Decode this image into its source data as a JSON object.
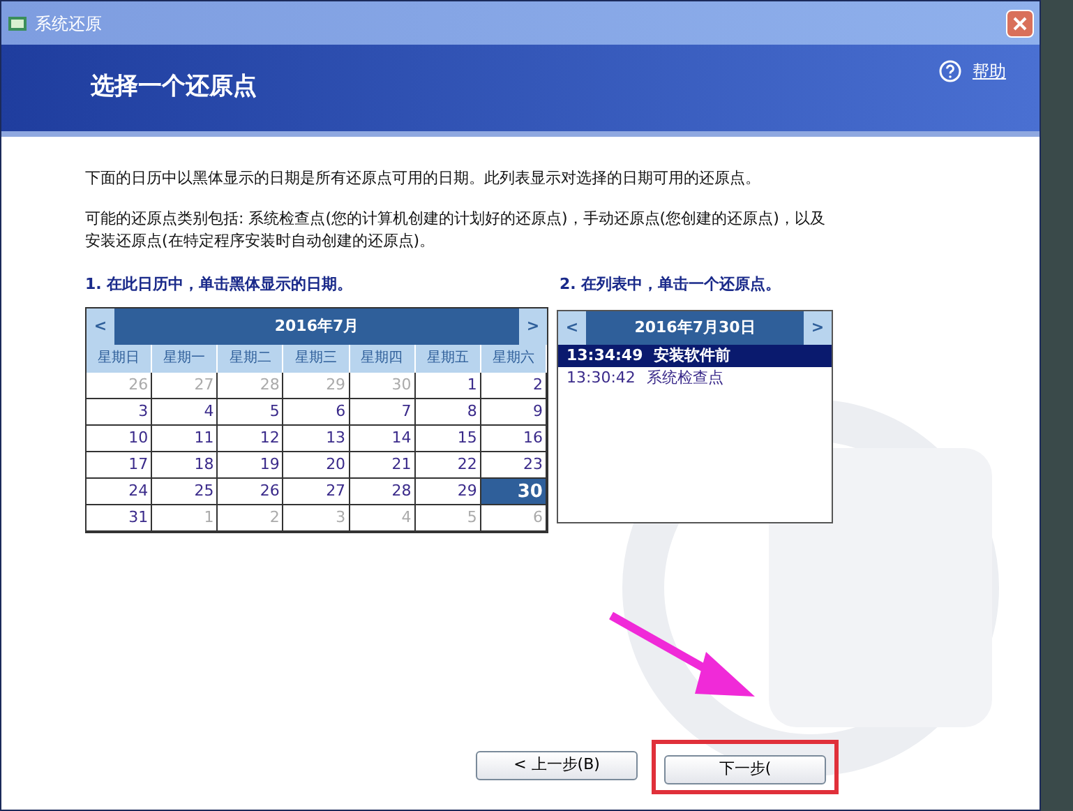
{
  "window": {
    "title": "系统还原"
  },
  "header": {
    "title": "选择一个还原点",
    "help": "帮助"
  },
  "description": "下面的日历中以黑体显示的日期是所有还原点可用的日期。此列表显示对选择的日期可用的还原点。",
  "types_note": "可能的还原点类别包括: 系统检查点(您的计算机创建的计划好的还原点)，手动还原点(您创建的还原点)，以及安装还原点(在特定程序安装时自动创建的还原点)。",
  "step1": "1. 在此日历中，单击黑体显示的日期。",
  "step2": "2. 在列表中，单击一个还原点。",
  "calendar": {
    "prev": "<",
    "next": ">",
    "month": "2016年7月",
    "weekdays": [
      "星期日",
      "星期一",
      "星期二",
      "星期三",
      "星期四",
      "星期五",
      "星期六"
    ],
    "weeks": [
      [
        {
          "day": "26",
          "in_month": false,
          "selected": false
        },
        {
          "day": "27",
          "in_month": false,
          "selected": false
        },
        {
          "day": "28",
          "in_month": false,
          "selected": false
        },
        {
          "day": "29",
          "in_month": false,
          "selected": false
        },
        {
          "day": "30",
          "in_month": false,
          "selected": false
        },
        {
          "day": "1",
          "in_month": true,
          "selected": false
        },
        {
          "day": "2",
          "in_month": true,
          "selected": false
        }
      ],
      [
        {
          "day": "3",
          "in_month": true,
          "selected": false
        },
        {
          "day": "4",
          "in_month": true,
          "selected": false
        },
        {
          "day": "5",
          "in_month": true,
          "selected": false
        },
        {
          "day": "6",
          "in_month": true,
          "selected": false
        },
        {
          "day": "7",
          "in_month": true,
          "selected": false
        },
        {
          "day": "8",
          "in_month": true,
          "selected": false
        },
        {
          "day": "9",
          "in_month": true,
          "selected": false
        }
      ],
      [
        {
          "day": "10",
          "in_month": true,
          "selected": false
        },
        {
          "day": "11",
          "in_month": true,
          "selected": false
        },
        {
          "day": "12",
          "in_month": true,
          "selected": false
        },
        {
          "day": "13",
          "in_month": true,
          "selected": false
        },
        {
          "day": "14",
          "in_month": true,
          "selected": false
        },
        {
          "day": "15",
          "in_month": true,
          "selected": false
        },
        {
          "day": "16",
          "in_month": true,
          "selected": false
        }
      ],
      [
        {
          "day": "17",
          "in_month": true,
          "selected": false
        },
        {
          "day": "18",
          "in_month": true,
          "selected": false
        },
        {
          "day": "19",
          "in_month": true,
          "selected": false
        },
        {
          "day": "20",
          "in_month": true,
          "selected": false
        },
        {
          "day": "21",
          "in_month": true,
          "selected": false
        },
        {
          "day": "22",
          "in_month": true,
          "selected": false
        },
        {
          "day": "23",
          "in_month": true,
          "selected": false
        }
      ],
      [
        {
          "day": "24",
          "in_month": true,
          "selected": false
        },
        {
          "day": "25",
          "in_month": true,
          "selected": false
        },
        {
          "day": "26",
          "in_month": true,
          "selected": false
        },
        {
          "day": "27",
          "in_month": true,
          "selected": false
        },
        {
          "day": "28",
          "in_month": true,
          "selected": false
        },
        {
          "day": "29",
          "in_month": true,
          "selected": false
        },
        {
          "day": "30",
          "in_month": true,
          "selected": true
        }
      ],
      [
        {
          "day": "31",
          "in_month": true,
          "selected": false
        },
        {
          "day": "1",
          "in_month": false,
          "selected": false
        },
        {
          "day": "2",
          "in_month": false,
          "selected": false
        },
        {
          "day": "3",
          "in_month": false,
          "selected": false
        },
        {
          "day": "4",
          "in_month": false,
          "selected": false
        },
        {
          "day": "5",
          "in_month": false,
          "selected": false
        },
        {
          "day": "6",
          "in_month": false,
          "selected": false
        }
      ]
    ]
  },
  "restore_points": {
    "prev": "<",
    "next": ">",
    "date": "2016年7月30日",
    "items": [
      {
        "time": "13:34:49",
        "name": "安装软件前",
        "selected": true
      },
      {
        "time": "13:30:42",
        "name": "系统检查点",
        "selected": false
      }
    ]
  },
  "buttons": [
    {
      "label": "< 上一步(B)",
      "highlighted": false
    },
    {
      "label": "下一步(",
      "highlighted": true
    }
  ]
}
